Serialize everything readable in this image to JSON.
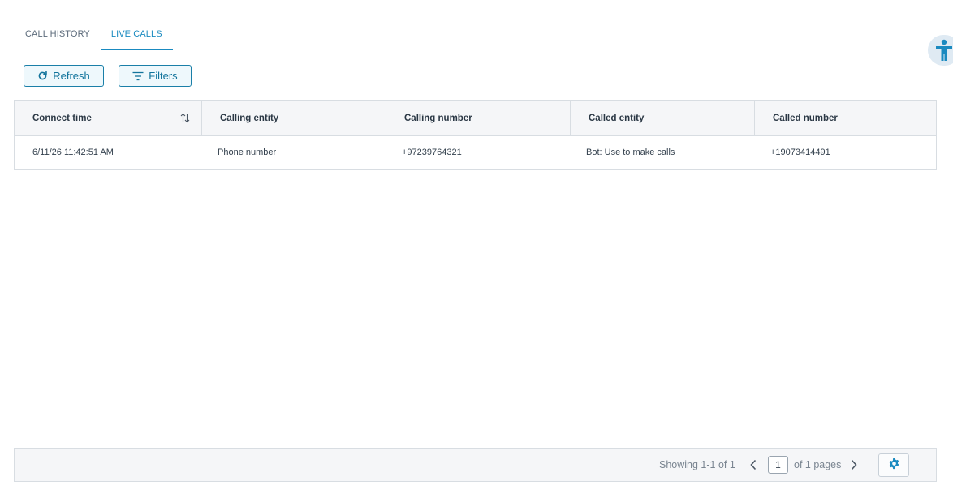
{
  "tabs": [
    {
      "label": "CALL HISTORY",
      "active": false
    },
    {
      "label": "LIVE CALLS",
      "active": true
    }
  ],
  "toolbar": {
    "refresh_label": "Refresh",
    "refresh_icon": "refresh-icon",
    "filters_label": "Filters",
    "filters_icon": "filter-icon"
  },
  "table": {
    "columns": [
      "Connect time",
      "Calling entity",
      "Calling number",
      "Called entity",
      "Called number"
    ],
    "rows": [
      [
        "6/11/26 11:42:51 AM",
        "Phone number",
        "+97239764321",
        "Bot: Use to make calls",
        "+19073414491"
      ]
    ]
  },
  "pagination": {
    "showing": "Showing 1-1 of 1",
    "page": "1",
    "of_pages": "of 1 pages"
  },
  "colors": {
    "accent": "#1a8ac0",
    "button_border": "#1a7fa8",
    "button_bg": "#eef8fc"
  }
}
